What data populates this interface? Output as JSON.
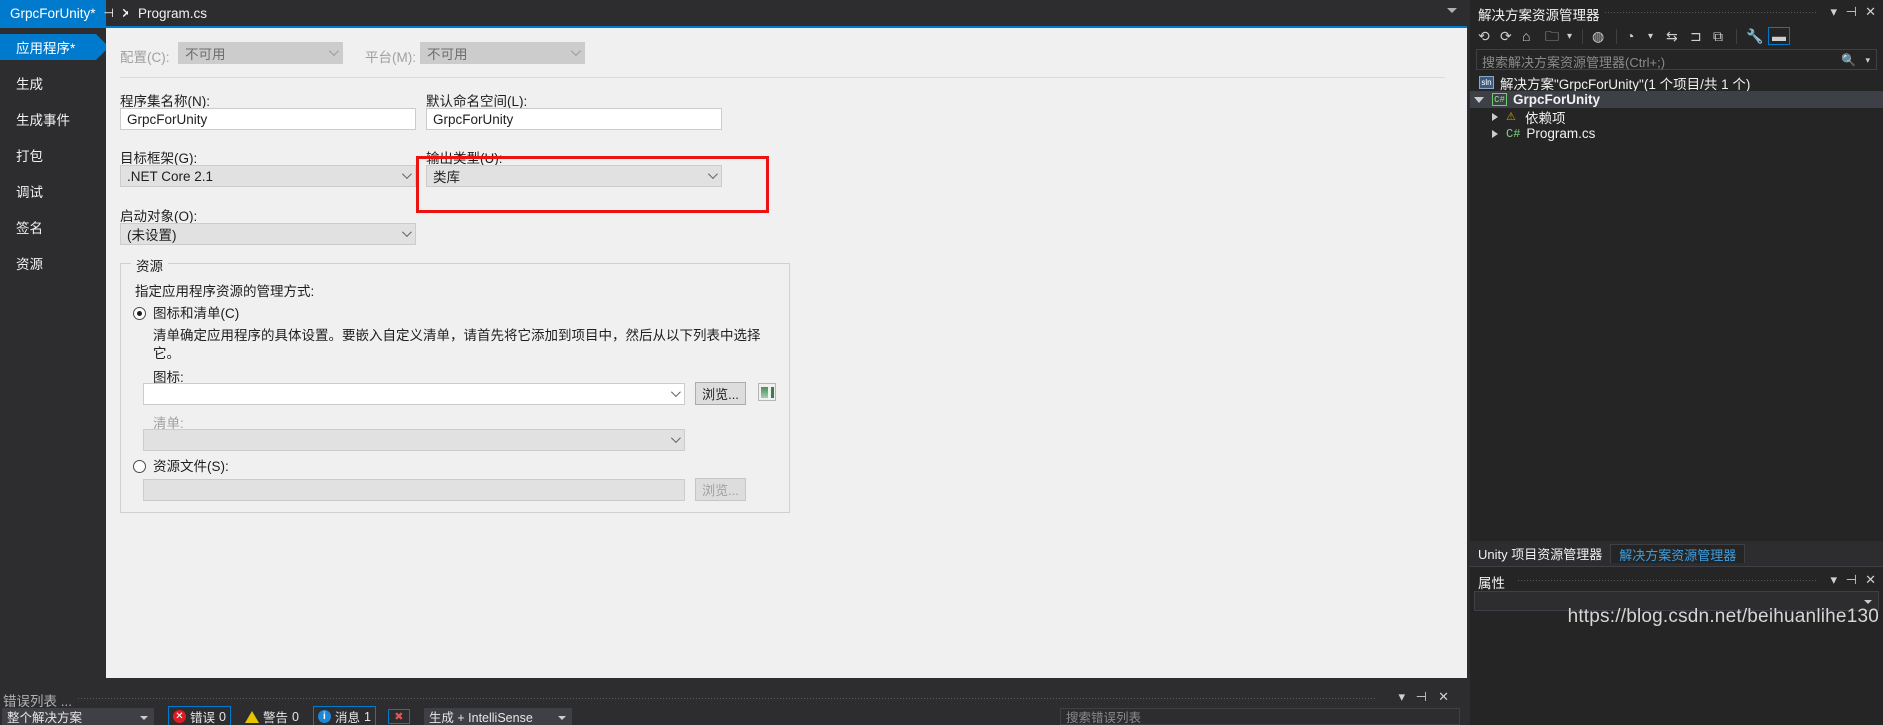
{
  "tabs": [
    {
      "title": "GrpcForUnity*",
      "active": true,
      "pin": "⊣",
      "close": "✕"
    },
    {
      "title": "Program.cs",
      "active": false
    }
  ],
  "vertical_tabs": [
    {
      "label": "应用程序*",
      "selected": true
    },
    {
      "label": "生成",
      "selected": false
    },
    {
      "label": "生成事件",
      "selected": false
    },
    {
      "label": "打包",
      "selected": false
    },
    {
      "label": "调试",
      "selected": false
    },
    {
      "label": "签名",
      "selected": false
    },
    {
      "label": "资源",
      "selected": false
    }
  ],
  "application_pane": {
    "configuration_label": "配置(C):",
    "configuration_value": "不可用",
    "platform_label": "平台(M):",
    "platform_value": "不可用",
    "assembly_name_label": "程序集名称(N):",
    "assembly_name_value": "GrpcForUnity",
    "default_namespace_label": "默认命名空间(L):",
    "default_namespace_value": "GrpcForUnity",
    "target_framework_label": "目标框架(G):",
    "target_framework_value": ".NET Core 2.1",
    "output_type_label": "输出类型(U):",
    "output_type_value": "类库",
    "startup_object_label": "启动对象(O):",
    "startup_object_value": "(未设置)",
    "resources_group_title": "资源",
    "resources_description": "指定应用程序资源的管理方式:",
    "icon_manifest_radio": "图标和清单(C)",
    "icon_manifest_help_line1": "清单确定应用程序的具体设置。要嵌入自定义清单，请首先将它添加到项目中，然后从以下列表中选择",
    "icon_manifest_help_line2": "它。",
    "icon_label": "图标:",
    "icon_value": "",
    "icon_browse_button": "浏览...",
    "manifest_label": "清单:",
    "manifest_value": "",
    "resource_file_radio": "资源文件(S):",
    "resource_file_value": "",
    "resource_file_browse_button": "浏览..."
  },
  "error_list": {
    "title": "错误列表 ...",
    "scope_value": "整个解决方案",
    "errors_label": "错误",
    "errors_count": "0",
    "warnings_label": "警告",
    "warnings_count": "0",
    "messages_label": "消息",
    "messages_count": "1",
    "build_filter": "生成 + IntelliSense",
    "search_placeholder": "搜索错误列表",
    "window_dropdown": "▾",
    "window_pin": "⊣",
    "window_close": "✕"
  },
  "solution_explorer": {
    "title": "解决方案资源管理器",
    "search_placeholder": "搜索解决方案资源管理器(Ctrl+;)",
    "window_dropdown": "▾",
    "window_pin": "⊣",
    "window_close": "✕",
    "toolbar_icons": [
      "back-icon",
      "forward-icon",
      "home-icon",
      "new-folder-icon",
      "toolbar-chevron-icon",
      "show-all-files-icon",
      "pending-changes-icon",
      "pending-chevron-icon",
      "sync-icon",
      "collapse-all-icon",
      "copy-icon",
      "properties-wrench-icon",
      "preview-selected-icon"
    ],
    "tree": [
      {
        "label": "解决方案\"GrpcForUnity\"(1 个项目/共 1 个)",
        "indent": 0,
        "icon": "solution-icon",
        "expander": "none",
        "selected": false,
        "highlighted": false
      },
      {
        "label": "GrpcForUnity",
        "indent": 1,
        "icon": "csharp-project-icon",
        "expander": "open",
        "selected": true,
        "highlighted": true
      },
      {
        "label": "依赖项",
        "indent": 2,
        "icon": "dependencies-icon",
        "expander": "closed",
        "selected": false,
        "highlighted": false
      },
      {
        "label": "Program.cs",
        "indent": 2,
        "icon": "csharp-file-icon",
        "expander": "closed",
        "selected": false,
        "highlighted": false
      }
    ]
  },
  "bottom_tabs": [
    {
      "label": "Unity 项目资源管理器",
      "active": false
    },
    {
      "label": "解决方案资源管理器",
      "active": true
    }
  ],
  "properties_panel": {
    "title": "属性",
    "window_dropdown": "▾",
    "window_pin": "⊣",
    "window_close": "✕"
  },
  "watermark": "https://blog.csdn.net/beihuanlihe130",
  "colors": {
    "accent": "#007acc",
    "highlight_box": "#ee1111",
    "dark_chrome": "#2d2d30",
    "panel_dark": "#252526",
    "pane_light": "#f0f0f0"
  }
}
